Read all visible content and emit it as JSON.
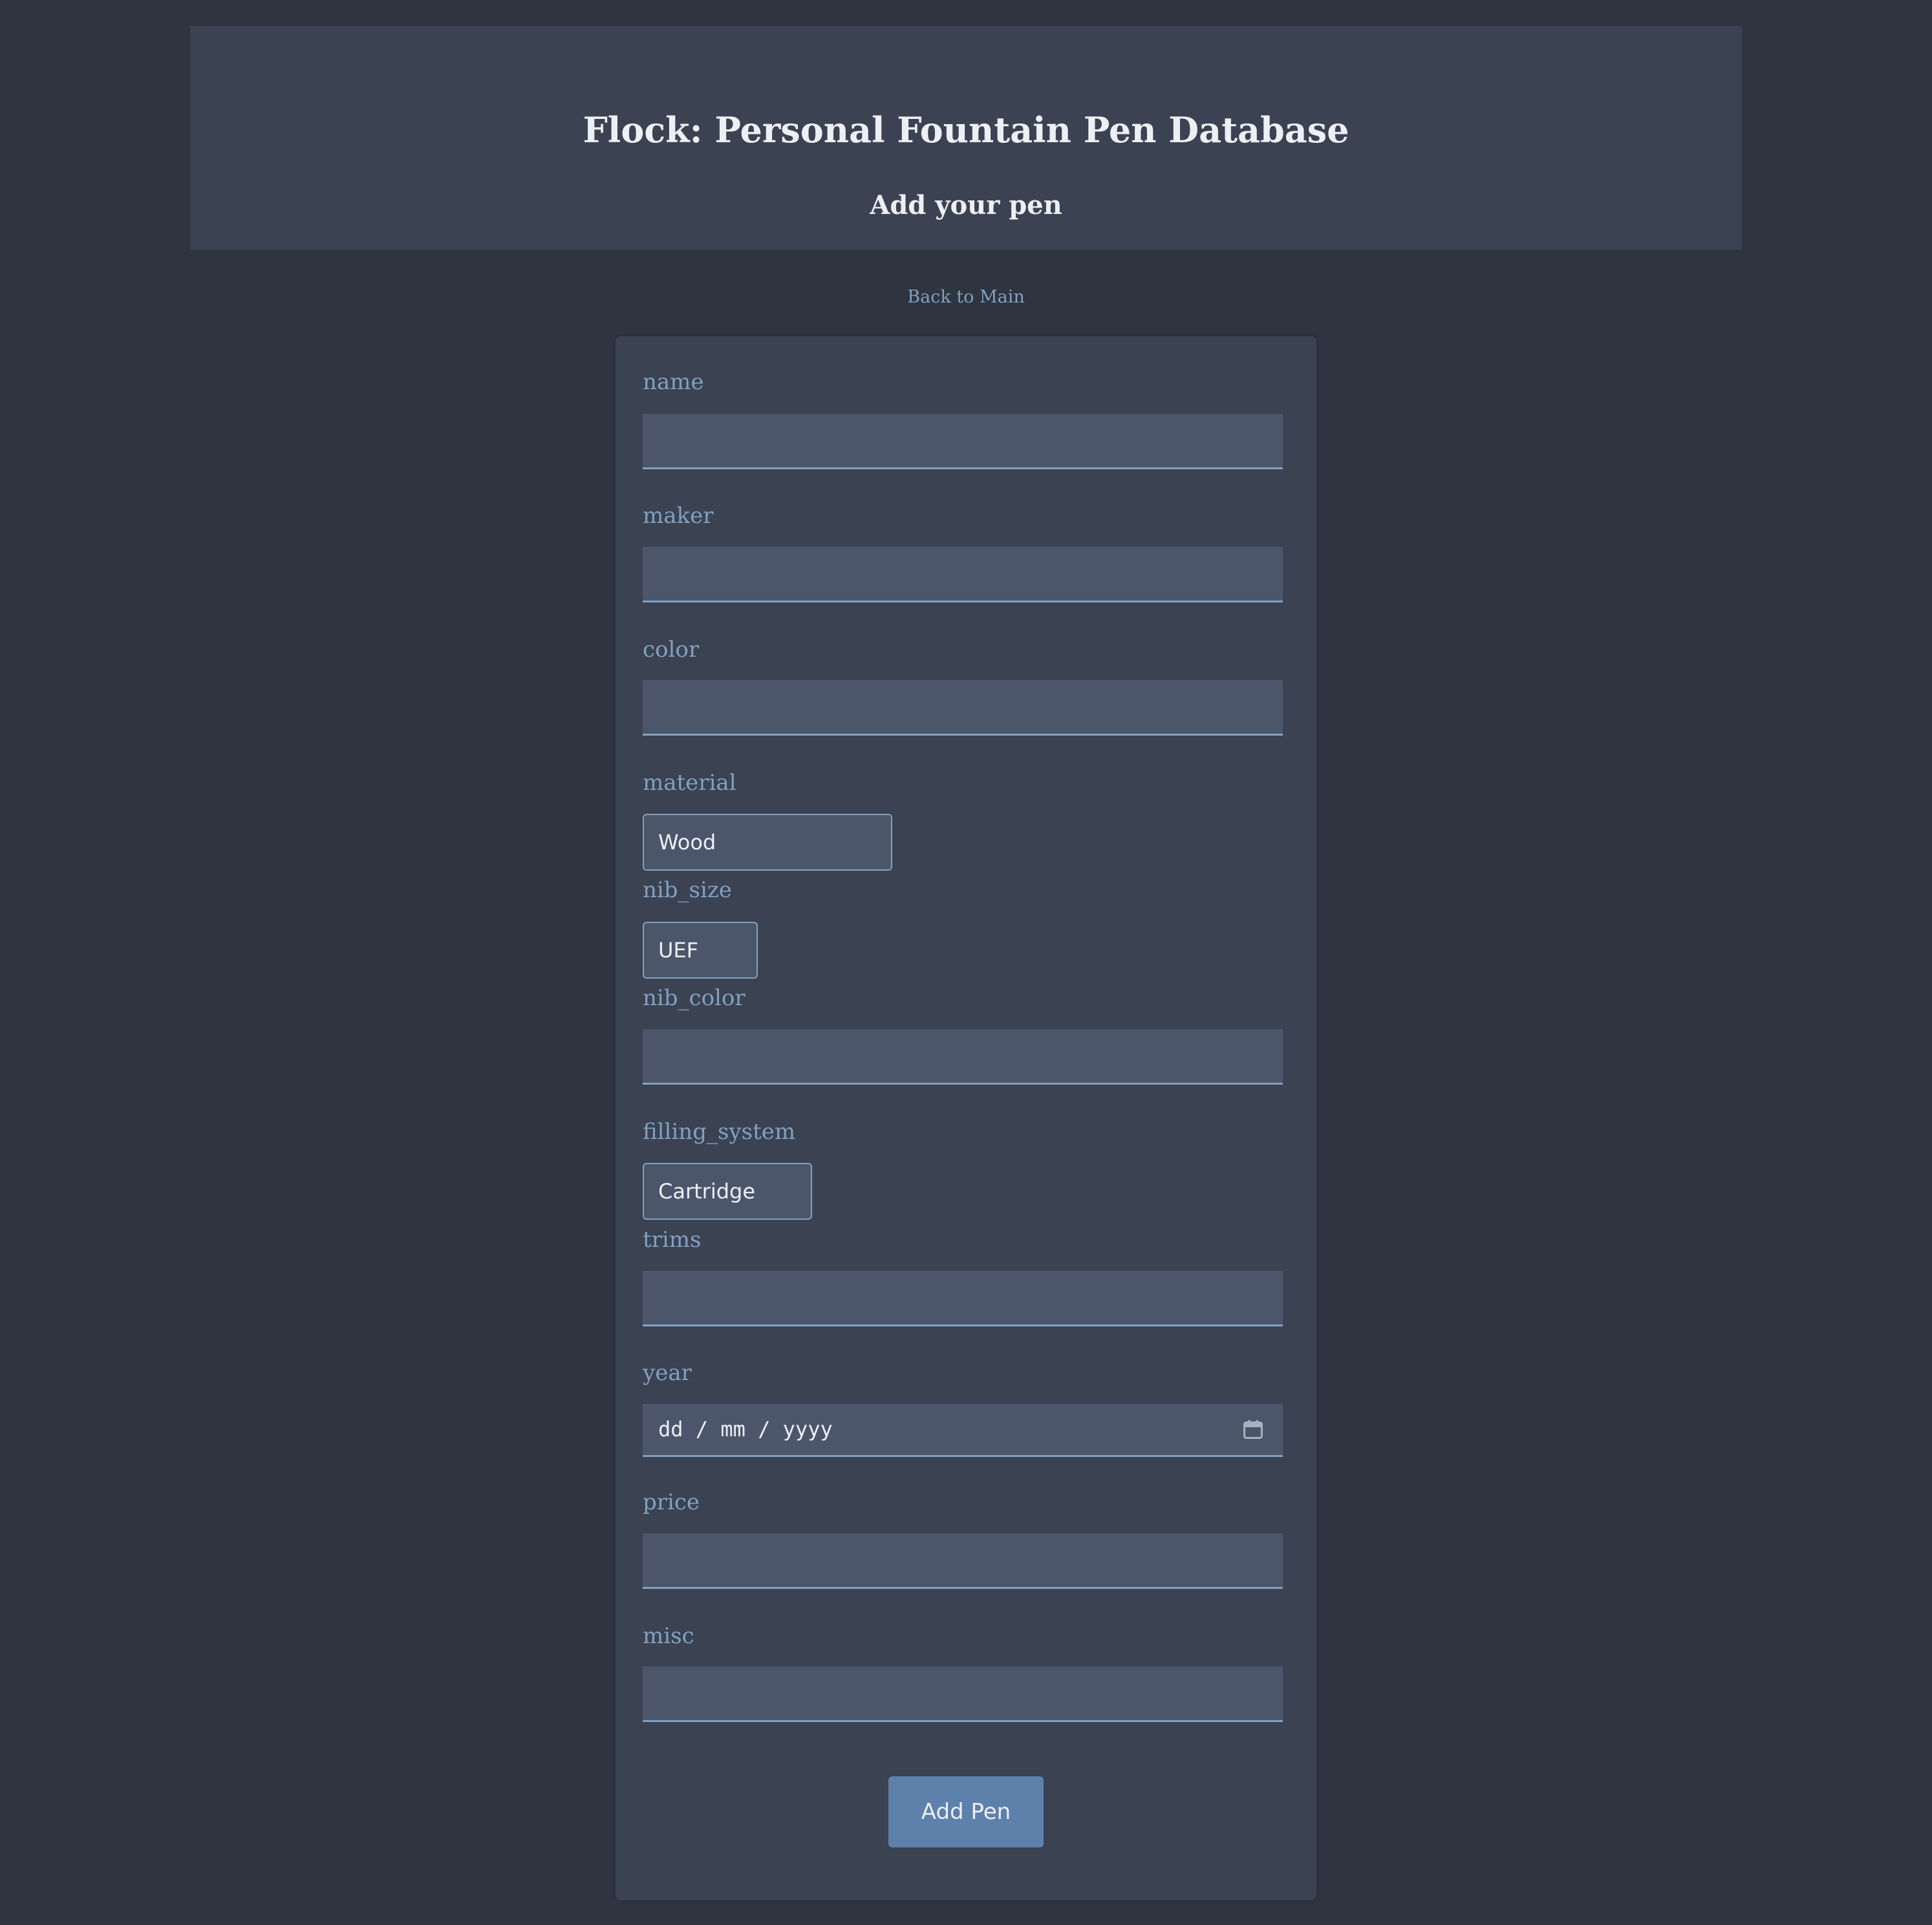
{
  "header": {
    "title": "Flock: Personal Fountain Pen Database",
    "subtitle": "Add your pen"
  },
  "nav": {
    "back_link": "Back to Main"
  },
  "form": {
    "fields": {
      "name": {
        "label": "name",
        "value": ""
      },
      "maker": {
        "label": "maker",
        "value": ""
      },
      "color": {
        "label": "color",
        "value": ""
      },
      "material": {
        "label": "material",
        "selected": "Wood"
      },
      "nib_size": {
        "label": "nib_size",
        "selected": "UEF"
      },
      "nib_color": {
        "label": "nib_color",
        "value": ""
      },
      "filling_system": {
        "label": "filling_system",
        "selected": "Cartridge"
      },
      "trims": {
        "label": "trims",
        "value": ""
      },
      "year": {
        "label": "year",
        "placeholder": "dd / mm / yyyy"
      },
      "price": {
        "label": "price",
        "value": ""
      },
      "misc": {
        "label": "misc",
        "value": ""
      }
    },
    "submit_label": "Add Pen"
  },
  "icons": {
    "year_picker": "calendar-icon"
  },
  "colors": {
    "background": "#2e3440",
    "panel": "#3b4252",
    "input": "#4c566a",
    "accent": "#81a1c1",
    "button": "#5e81ac",
    "text": "#eceff4"
  }
}
